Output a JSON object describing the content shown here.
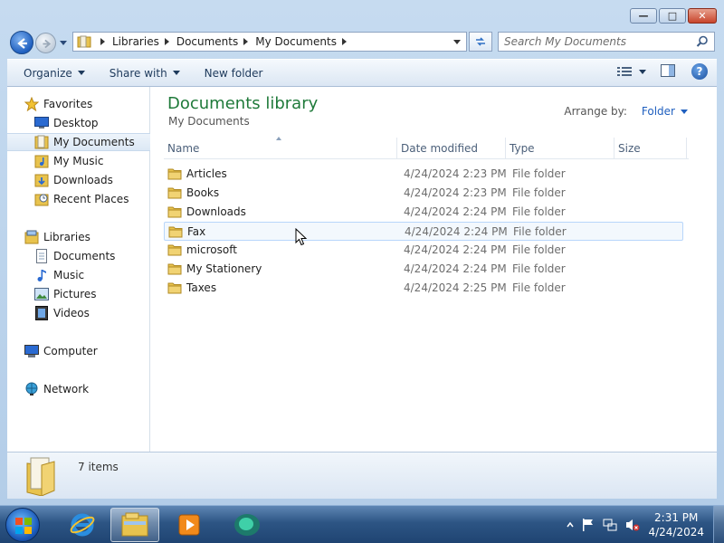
{
  "window": {
    "caption_buttons": [
      "minimize",
      "maximize",
      "close"
    ]
  },
  "address_bar": {
    "breadcrumbs": [
      "Libraries",
      "Documents",
      "My Documents"
    ]
  },
  "search": {
    "placeholder": "Search My Documents"
  },
  "toolbar": {
    "organize": "Organize",
    "share_with": "Share with",
    "new_folder": "New folder"
  },
  "nav": {
    "favorites": "Favorites",
    "desktop": "Desktop",
    "my_documents": "My Documents",
    "my_music": "My Music",
    "downloads": "Downloads",
    "recent_places": "Recent Places",
    "libraries": "Libraries",
    "documents": "Documents",
    "music": "Music",
    "pictures": "Pictures",
    "videos": "Videos",
    "computer": "Computer",
    "network": "Network"
  },
  "library": {
    "title": "Documents library",
    "subtitle": "My Documents",
    "arrange_label": "Arrange by:",
    "arrange_value": "Folder"
  },
  "columns": {
    "name": "Name",
    "date": "Date modified",
    "type": "Type",
    "size": "Size"
  },
  "files": [
    {
      "name": "Articles",
      "date": "4/24/2024 2:23 PM",
      "type": "File folder"
    },
    {
      "name": "Books",
      "date": "4/24/2024 2:23 PM",
      "type": "File folder"
    },
    {
      "name": "Downloads",
      "date": "4/24/2024 2:24 PM",
      "type": "File folder"
    },
    {
      "name": "Fax",
      "date": "4/24/2024 2:24 PM",
      "type": "File folder"
    },
    {
      "name": "microsoft",
      "date": "4/24/2024 2:24 PM",
      "type": "File folder"
    },
    {
      "name": "My Stationery",
      "date": "4/24/2024 2:24 PM",
      "type": "File folder"
    },
    {
      "name": "Taxes",
      "date": "4/24/2024 2:25 PM",
      "type": "File folder"
    }
  ],
  "details": {
    "count": "7 items"
  },
  "taskbar": {
    "time": "2:31 PM",
    "date": "4/24/2024"
  },
  "colors": {
    "library_title": "#1f7a3a",
    "link_blue": "#1f5fbf",
    "folder_yellow": "#e8c34e"
  }
}
